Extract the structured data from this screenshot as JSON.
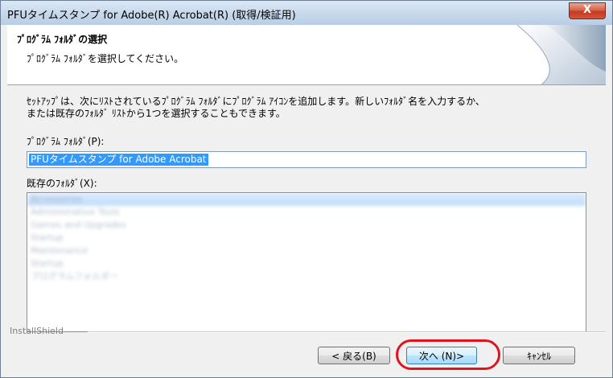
{
  "window": {
    "title": "PFUタイムスタンプ for Adobe(R) Acrobat(R) (取得/検証用)",
    "close_label": "X"
  },
  "header": {
    "title": "ﾌﾟﾛｸﾞﾗﾑ ﾌｫﾙﾀﾞの選択",
    "subtitle": "ﾌﾟﾛｸﾞﾗﾑ ﾌｫﾙﾀﾞを選択してください。"
  },
  "body": {
    "description_line1": "ｾｯﾄｱｯﾌﾟは、次にﾘｽﾄされているﾌﾟﾛｸﾞﾗﾑ ﾌｫﾙﾀﾞにﾌﾟﾛｸﾞﾗﾑ ｱｲｺﾝを追加します。新しいﾌｫﾙﾀﾞ名を入力するか、",
    "description_line2": "または既存のﾌｫﾙﾀﾞ ﾘｽﾄから1つを選択することもできます。",
    "program_folder_label": "ﾌﾟﾛｸﾞﾗﾑ ﾌｫﾙﾀﾞ(P):",
    "program_folder_value": "PFUタイムスタンプ for Adobe Acrobat",
    "existing_folders_label": "既存のﾌｫﾙﾀﾞ(X):",
    "existing_folders": [
      "Accessories",
      "Administrative Tools",
      "Games and Upgrades",
      "Startup",
      "Maintenance",
      "Startup",
      "プログラムフォルダー"
    ]
  },
  "footer": {
    "brand": "InstallShield",
    "back_label": "< 戻る(B)",
    "next_label": "次へ (N)>",
    "cancel_label": "ｷｬﾝｾﾙ"
  }
}
